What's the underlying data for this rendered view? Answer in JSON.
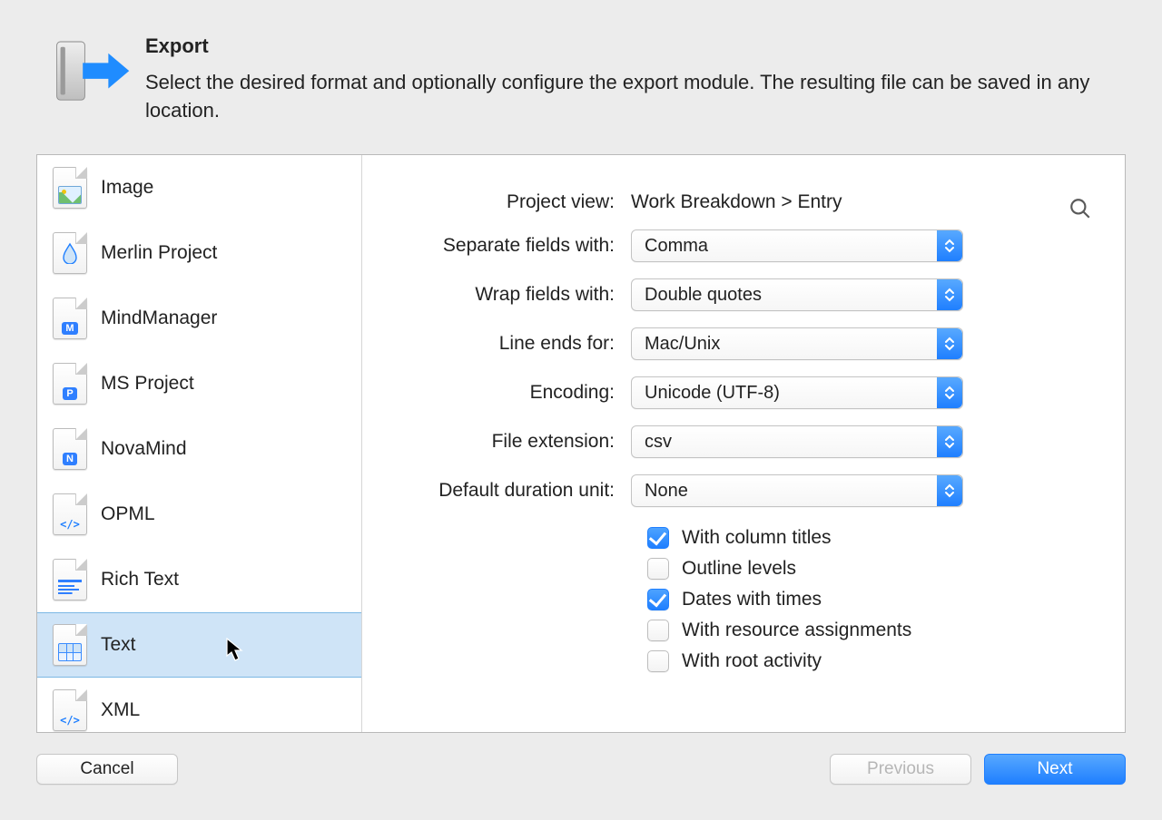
{
  "header": {
    "title": "Export",
    "description": "Select the desired format and optionally configure the export module. The resulting file can be saved in any location."
  },
  "sidebar": {
    "items": [
      {
        "label": "Image",
        "icon": "image-icon"
      },
      {
        "label": "Merlin Project",
        "icon": "merlin-icon"
      },
      {
        "label": "MindManager",
        "icon": "mindmanager-icon"
      },
      {
        "label": "MS Project",
        "icon": "msproject-icon"
      },
      {
        "label": "NovaMind",
        "icon": "novamind-icon"
      },
      {
        "label": "OPML",
        "icon": "opml-icon"
      },
      {
        "label": "Rich Text",
        "icon": "richtext-icon"
      },
      {
        "label": "Text",
        "icon": "text-icon"
      },
      {
        "label": "XML",
        "icon": "xml-icon"
      }
    ],
    "selected_index": 7
  },
  "config": {
    "labels": {
      "project_view": "Project view:",
      "separate": "Separate fields with:",
      "wrap": "Wrap fields with:",
      "line_ends": "Line ends for:",
      "encoding": "Encoding:",
      "file_ext": "File extension:",
      "duration": "Default duration unit:"
    },
    "project_view_value": "Work Breakdown > Entry",
    "selects": {
      "separate": "Comma",
      "wrap": "Double quotes",
      "line_ends": "Mac/Unix",
      "encoding": "Unicode (UTF-8)",
      "file_ext": "csv",
      "duration": "None"
    },
    "checkboxes": [
      {
        "label": "With column titles",
        "checked": true
      },
      {
        "label": "Outline levels",
        "checked": false
      },
      {
        "label": "Dates with times",
        "checked": true
      },
      {
        "label": "With resource assignments",
        "checked": false
      },
      {
        "label": "With root activity",
        "checked": false
      }
    ]
  },
  "footer": {
    "cancel": "Cancel",
    "previous": "Previous",
    "next": "Next",
    "previous_enabled": false
  }
}
